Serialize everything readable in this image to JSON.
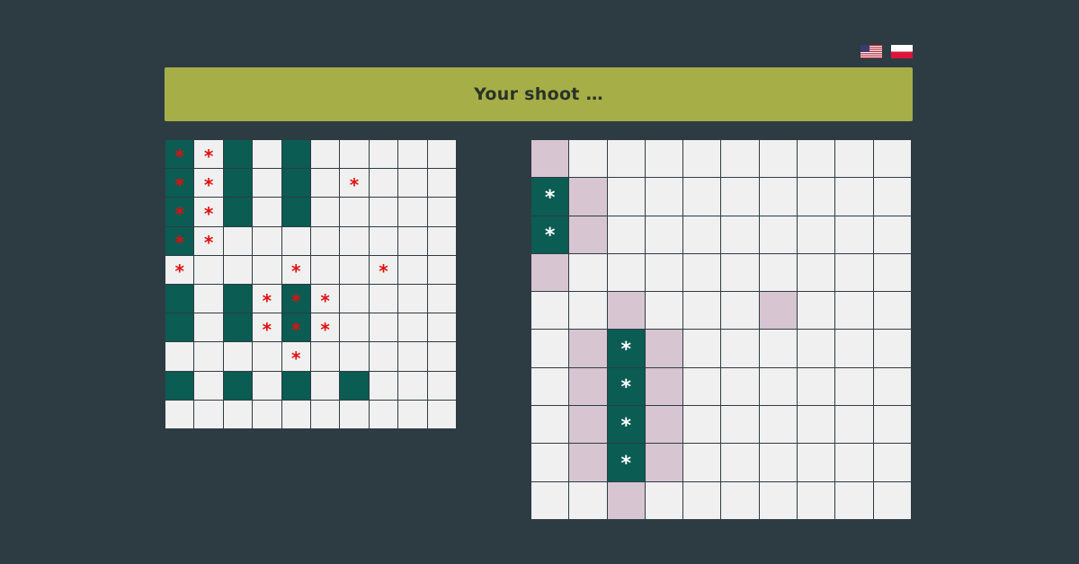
{
  "flags": [
    "us-flag-icon",
    "pl-flag-icon"
  ],
  "status": {
    "message": "Your shoot …"
  },
  "colors": {
    "background": "#2d3c43",
    "banner": "#a6ae48",
    "ship": "#0b5c53",
    "near_miss": "#d7c5d1",
    "empty": "#f0f0f0",
    "hit_mark_own": "#e20f0f",
    "hit_mark_enemy": "#ffffff"
  },
  "legend": {
    "S": "ship",
    "H": "ship hit",
    "X": "shot miss",
    "N": "blocked neighbour",
    ".": "empty"
  },
  "own_board": {
    "rows": [
      "HXS.S.....",
      "HXS.S.X...",
      "HXS.S.....",
      "HX........",
      "X...X..X..",
      "S.SXHX....",
      "S.SXHX....",
      "....X.....",
      "S.S.S.S...",
      ".........."
    ]
  },
  "enemy_board": {
    "rows": [
      "N.........",
      "HN........",
      "HN........",
      "N.........",
      "..N...N...",
      ".NHN......",
      ".NHN......",
      ".NHN......",
      ".NHN......",
      "..N......."
    ]
  }
}
